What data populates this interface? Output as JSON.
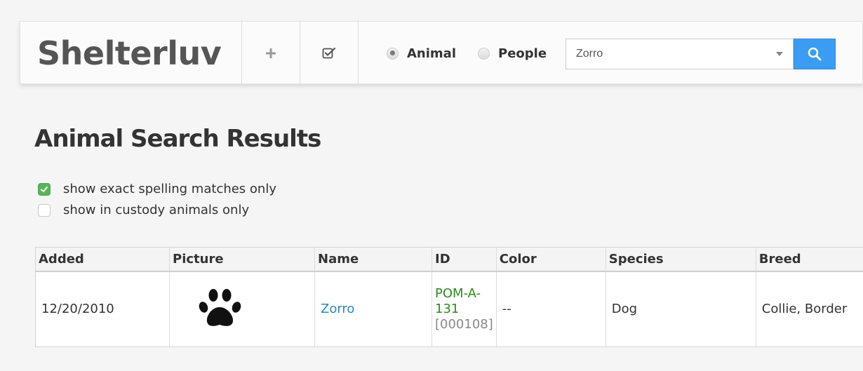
{
  "header": {
    "brand": "Shelterluv",
    "add_icon": "plus-icon",
    "tasks_icon": "checkbox-icon",
    "search_type": {
      "options": [
        "Animal",
        "People"
      ],
      "selected": "Animal"
    },
    "search": {
      "value": "Zorro",
      "button_icon": "search-icon"
    }
  },
  "main": {
    "title": "Animal Search Results",
    "filters": [
      {
        "label": "show exact spelling matches only",
        "checked": true
      },
      {
        "label": "show in custody animals only",
        "checked": false
      }
    ],
    "table": {
      "columns": [
        "Added",
        "Picture",
        "Name",
        "ID",
        "Color",
        "Species",
        "Breed"
      ],
      "rows": [
        {
          "added": "12/20/2010",
          "picture": "paw-print-icon",
          "name": "Zorro",
          "id_line1": "POM-A-",
          "id_line2": "131",
          "id_internal": "[000108]",
          "color": "--",
          "species": "Dog",
          "breed": "Collie, Border"
        }
      ]
    }
  },
  "colors": {
    "accent_blue": "#3a9cf3",
    "link_blue": "#2a86c8",
    "id_green": "#2a8a1e",
    "checkbox_green": "#5bb45c"
  }
}
